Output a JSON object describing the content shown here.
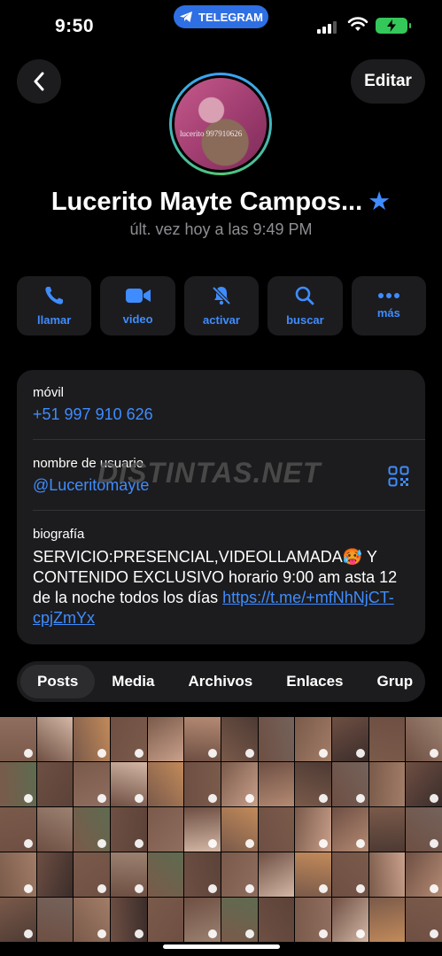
{
  "status_bar": {
    "time": "9:50",
    "pill_label": "TELEGRAM"
  },
  "header": {
    "edit_label": "Editar"
  },
  "profile": {
    "avatar_watermark": "lucerito 997910626",
    "name": "Lucerito Mayte Campos...",
    "last_seen": "últ. vez hoy a las 9:49 PM"
  },
  "actions": [
    {
      "label": "llamar",
      "icon": "phone-icon"
    },
    {
      "label": "video",
      "icon": "video-icon"
    },
    {
      "label": "activar",
      "icon": "bell-slash-icon"
    },
    {
      "label": "buscar",
      "icon": "search-icon"
    },
    {
      "label": "más",
      "icon": "more-icon"
    }
  ],
  "info": {
    "mobile_label": "móvil",
    "mobile_value": "+51 997 910 626",
    "username_label": "nombre de usuario",
    "username_value": "@Luceritomayte",
    "bio_label": "biografía",
    "bio_text": "SERVICIO:PRESENCIAL,VIDEOLLAMADA🥵 Y CONTENIDO EXCLUSIVO horario 9:00 am asta 12 de la noche todos los días ",
    "bio_link": "https://t.me/+mfNhNjCT-cpjZmYx"
  },
  "watermark": "DISTINTAS.NET",
  "tabs": [
    "Posts",
    "Media",
    "Archivos",
    "Enlaces",
    "Grup"
  ],
  "colors": {
    "accent": "#3f8cff",
    "card": "#1c1c1e",
    "battery": "#34c759",
    "pill": "#2f6fe4"
  }
}
